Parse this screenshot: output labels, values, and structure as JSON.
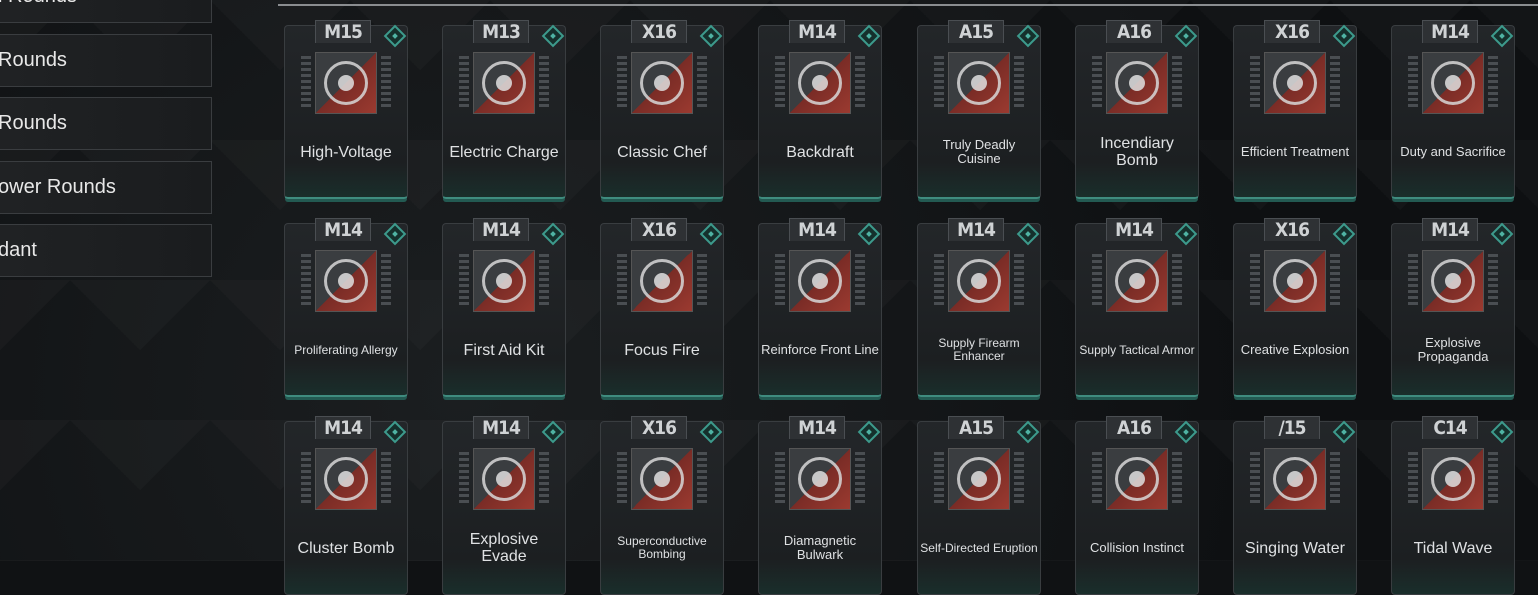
{
  "sidebar": {
    "items": [
      {
        "label": "l Rounds"
      },
      {
        "label": " Rounds"
      },
      {
        "label": " Rounds"
      },
      {
        "label": "ower Rounds"
      },
      {
        "label": "dant"
      }
    ]
  },
  "cards": [
    {
      "name": "High-Voltage",
      "tier": "M15",
      "icon": "skull-target-icon"
    },
    {
      "name": "Electric Charge",
      "tier": "M13",
      "icon": "battery-charge-icon"
    },
    {
      "name": "Classic Chef",
      "tier": "X16",
      "icon": "chef-hat-icon"
    },
    {
      "name": "Backdraft",
      "tier": "M14",
      "icon": "fire-swirl-icon"
    },
    {
      "name": "Truly Deadly Cuisine",
      "tier": "A15",
      "icon": "spiked-gear-icon"
    },
    {
      "name": "Incendiary Bomb",
      "tier": "A16",
      "icon": "flame-icon"
    },
    {
      "name": "Efficient Treatment",
      "tier": "X16",
      "icon": "figure-aura-icon"
    },
    {
      "name": "Duty and Sacrifice",
      "tier": "M14",
      "icon": "dome-icon"
    },
    {
      "name": "Proliferating Allergy",
      "tier": "M14",
      "icon": "cluster-orbs-icon"
    },
    {
      "name": "First Aid Kit",
      "tier": "M14",
      "icon": "medkit-icon"
    },
    {
      "name": "Focus Fire",
      "tier": "X16",
      "icon": "bullets-icon"
    },
    {
      "name": "Reinforce Front Line",
      "tier": "M14",
      "icon": "rifle-drone-icon"
    },
    {
      "name": "Supply Firearm Enhancer",
      "tier": "M14",
      "icon": "supply-drop-icon"
    },
    {
      "name": "Supply Tactical Armor",
      "tier": "M14",
      "icon": "armor-canister-icon"
    },
    {
      "name": "Creative Explosion",
      "tier": "X16",
      "icon": "explosion-figure-icon"
    },
    {
      "name": "Explosive Propaganda",
      "tier": "M14",
      "icon": "target-burst-icon"
    },
    {
      "name": "Cluster Bomb",
      "tier": "M14",
      "icon": "flaming-ball-icon"
    },
    {
      "name": "Explosive Evade",
      "tier": "M14",
      "icon": "dash-explosion-icon"
    },
    {
      "name": "Superconductive Bombing",
      "tier": "X16",
      "icon": "grenade-icon"
    },
    {
      "name": "Diamagnetic Bulwark",
      "tier": "M14",
      "icon": "shield-bolt-icon"
    },
    {
      "name": "Self-Directed Eruption",
      "tier": "A15",
      "icon": "lightning-burst-icon"
    },
    {
      "name": "Collision Instinct",
      "tier": "A16",
      "icon": "running-shield-icon"
    },
    {
      "name": "Singing Water",
      "tier": "/15",
      "icon": "pearl-icon"
    },
    {
      "name": "Tidal Wave",
      "tier": "C14",
      "icon": "wave-surfer-icon"
    }
  ]
}
